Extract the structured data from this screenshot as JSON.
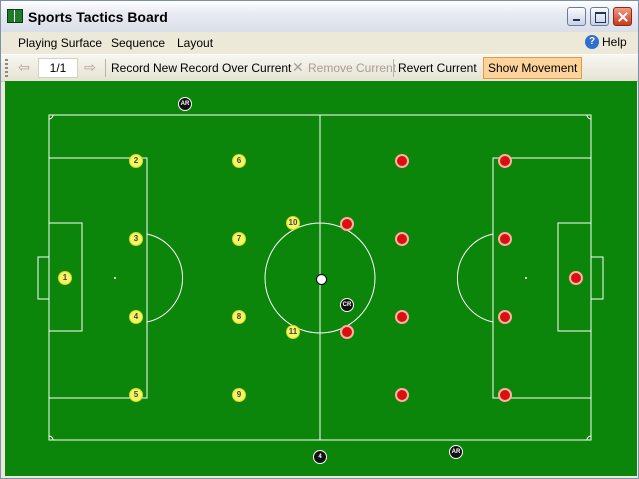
{
  "window": {
    "title": "Sports Tactics Board"
  },
  "menu": {
    "items": [
      {
        "label": "Playing Surface"
      },
      {
        "label": "Sequence"
      },
      {
        "label": "Layout"
      }
    ],
    "help": "Help"
  },
  "toolbar": {
    "page": "1/1",
    "record_new": "Record New",
    "record_over": "Record Over Current",
    "remove_current": "Remove Current",
    "revert_current": "Revert Current",
    "show_movement": "Show Movement"
  },
  "board": {
    "yellow_team": [
      "1",
      "2",
      "3",
      "4",
      "5",
      "6",
      "7",
      "8",
      "9",
      "10",
      "11"
    ],
    "officials": [
      "AR",
      "CR",
      "4",
      "AR"
    ],
    "colors": {
      "pitch": "#0b850a",
      "home": "#f5f564",
      "away": "#d81010",
      "officials": "#111111"
    }
  }
}
